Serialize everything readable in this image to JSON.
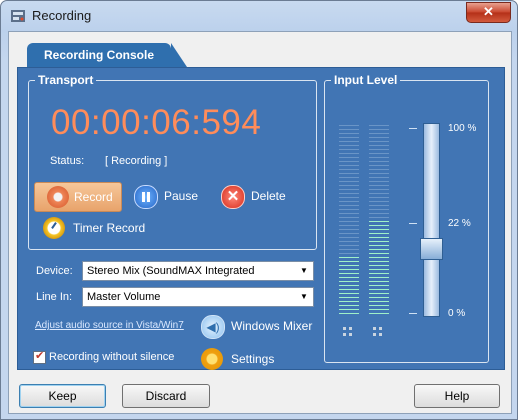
{
  "window": {
    "title": "Recording",
    "close_glyph": "✕"
  },
  "tab": {
    "label": "Recording Console"
  },
  "transport": {
    "title": "Transport",
    "time": "00:00:06:594",
    "status_label": "Status:",
    "status_value": "[ Recording ]",
    "record_label": "Record",
    "pause_label": "Pause",
    "delete_label": "Delete",
    "delete_glyph": "✕",
    "timer_record_label": "Timer Record"
  },
  "device": {
    "label": "Device:",
    "value": "Stereo Mix (SoundMAX Integrated",
    "arrow": "▼"
  },
  "line_in": {
    "label": "Line In:",
    "value": "Master Volume",
    "arrow": "▼"
  },
  "adjust_link": "Adjust audio source in Vista/Win7",
  "windows_mixer_label": "Windows Mixer",
  "mixer_glyph": "◀)",
  "settings_label": "Settings",
  "recording_without_silence": {
    "label": "Recording without silence",
    "checked": true
  },
  "input_level": {
    "title": "Input Level",
    "top_label": "100 %",
    "mid_label": "22 %",
    "bottom_label": "0 %",
    "left_meter_level": 0.32,
    "right_meter_level": 0.5,
    "slider_value": 0.22
  },
  "colors": {
    "accent": "#4175b4",
    "timer": "#ff8c5a",
    "meter_on": "#9ff0c8",
    "meter_off": "#6a95c7"
  },
  "buttons": {
    "keep": "Keep",
    "discard": "Discard",
    "help": "Help"
  }
}
